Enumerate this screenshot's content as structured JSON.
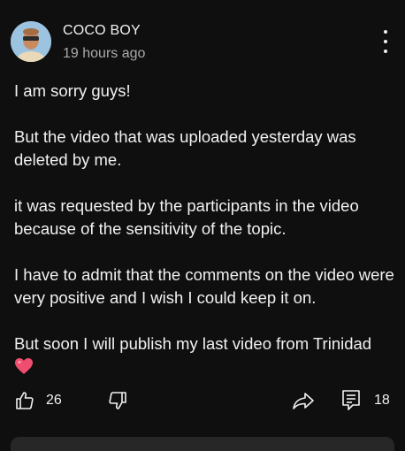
{
  "post": {
    "author": "COCO BOY",
    "time": "19 hours ago",
    "paragraphs": [
      "I am sorry guys!",
      "But the video that was uploaded yesterday was deleted by me.",
      "it was requested by the participants in the video because of the sensitivity of the topic.",
      "I have to admit that the comments on the video were very positive and I wish I could keep it on.",
      "But soon I will publish my last video from Trinidad"
    ],
    "emoji": "heart-emoji"
  },
  "actions": {
    "like_count": "26",
    "comment_count": "18",
    "icons": [
      "thumbs-up-icon",
      "thumbs-down-icon",
      "share-icon",
      "comment-icon"
    ]
  },
  "colors": {
    "background": "#0f0f0f",
    "text": "#f1f1f1",
    "secondary_text": "#aaaaaa",
    "heart": "#f04e6e"
  }
}
